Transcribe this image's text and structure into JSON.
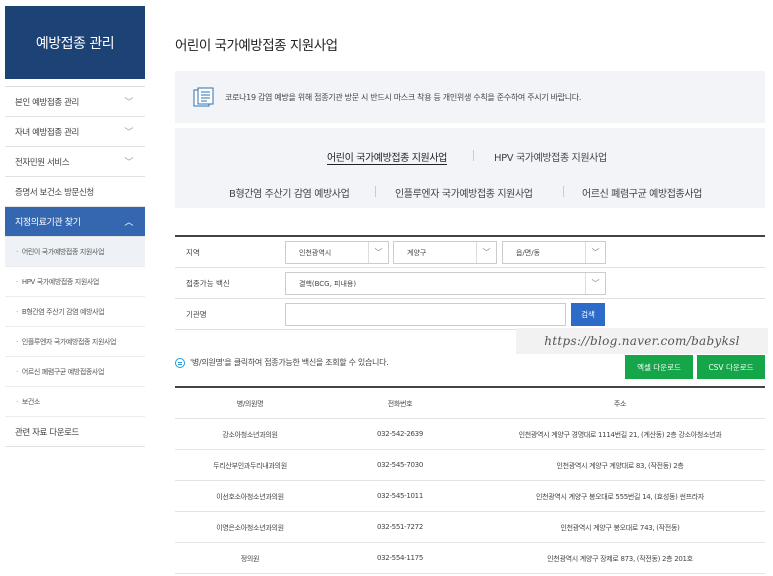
{
  "sidebar": {
    "title": "예방접종 관리",
    "items": [
      {
        "label": "본인 예방접종 관리",
        "chevron": "﹀"
      },
      {
        "label": "자녀 예방접종 관리",
        "chevron": "﹀"
      },
      {
        "label": "전자민원 서비스",
        "chevron": "﹀"
      },
      {
        "label": "증명서 보건소 방문신청",
        "chevron": ""
      },
      {
        "label": "지정의료기관 찾기",
        "chevron": "︿"
      }
    ],
    "subitems": [
      "어린이 국가예방접종 지원사업",
      "HPV 국가예방접종 지원사업",
      "B형간염 주산기 감염 예방사업",
      "인플루엔자 국가예방접종 지원사업",
      "어르신 폐렴구균 예방접종사업",
      "보건소"
    ],
    "last_item": "관련 자료 다운로드"
  },
  "page": {
    "title": "어린이 국가예방접종 지원사업",
    "notice": "코로나19 감염 예방을 위해 접종기관 방문 시 반드시 마스크 착용 등 개인위생 수칙을 준수하여 주시기 바랍니다."
  },
  "tabs": [
    "어린이 국가예방접종 지원사업",
    "HPV 국가예방접종 지원사업",
    "B형간염 주산기 감염 예방사업",
    "인플루엔자 국가예방접종 지원사업",
    "어르신 폐렴구균 예방접종사업"
  ],
  "form": {
    "region_label": "지역",
    "region_city": "인천광역시",
    "region_district": "계양구",
    "region_town": "읍/면/동",
    "vaccine_label": "접종가능 백신",
    "vaccine_value": "결핵(BCG, 피내용)",
    "name_label": "기관명",
    "search_button": "검색"
  },
  "watermark": "https://blog.naver.com/babyksl",
  "hint": "'병/의원명'을 클릭하여 접종가능한 백신을 조회할 수 있습니다.",
  "downloads": {
    "excel": "엑셀 다운로드",
    "csv": "CSV 다운로드"
  },
  "table": {
    "headers": [
      "병/의원명",
      "전화번호",
      "주소"
    ],
    "rows": [
      [
        "강소아청소년과의원",
        "032-542-2639",
        "인천광역시 계양구 경명대로 1114번길 21, (계산동) 2층 강소아청소년과"
      ],
      [
        "두리산부인과두리내과의원",
        "032-545-7030",
        "인천광역시 계양구 계양대로 83, (작전동) 2층"
      ],
      [
        "이선호소아청소년과의원",
        "032-545-1011",
        "인천광역시 계양구 봉오대로 555번길 14, (효성동) 썬프라자"
      ],
      [
        "이영은소아청소년과의원",
        "032-551-7272",
        "인천광역시 계양구 봉오대로 743, (작전동)"
      ],
      [
        "정의원",
        "032-554-1175",
        "인천광역시 계양구 장제로 873, (작전동) 2층 201호"
      ]
    ]
  },
  "colors": {
    "sidebar_head": "#1d4275",
    "active_item": "#3467b0",
    "search_button": "#2d6bc9",
    "download_button": "#15a64a"
  }
}
